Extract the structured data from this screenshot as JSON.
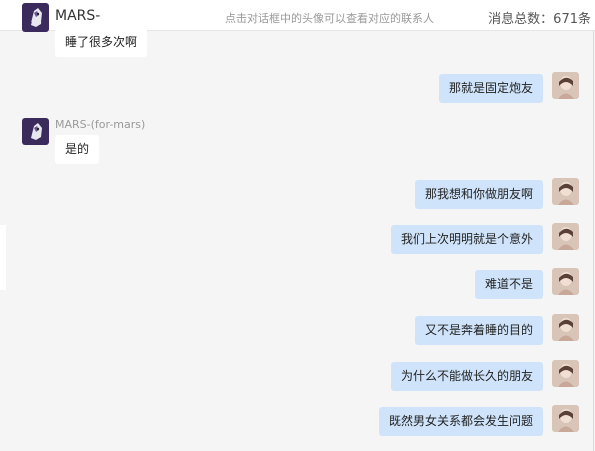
{
  "header": {
    "contact_name": "MARS-",
    "hint": "点击对话框中的头像可以查看对应的联系人",
    "total_label": "消息总数：671条"
  },
  "messages": [
    {
      "side": "left",
      "text": "睡了很多次啊",
      "sender": ""
    },
    {
      "side": "right",
      "text": "那就是固定炮友"
    },
    {
      "side": "left",
      "text": "是的",
      "sender": "MARS-(for-mars)"
    },
    {
      "side": "right",
      "text": "那我想和你做朋友啊"
    },
    {
      "side": "right",
      "text": "我们上次明明就是个意外"
    },
    {
      "side": "right",
      "text": "难道不是"
    },
    {
      "side": "right",
      "text": "又不是奔着睡的目的"
    },
    {
      "side": "right",
      "text": "为什么不能做长久的朋友"
    },
    {
      "side": "right",
      "text": "既然男女关系都会发生问题"
    }
  ],
  "icons": {
    "contact_avatar": "wolf-avatar-icon",
    "self_avatar": "person-photo-avatar-icon"
  }
}
